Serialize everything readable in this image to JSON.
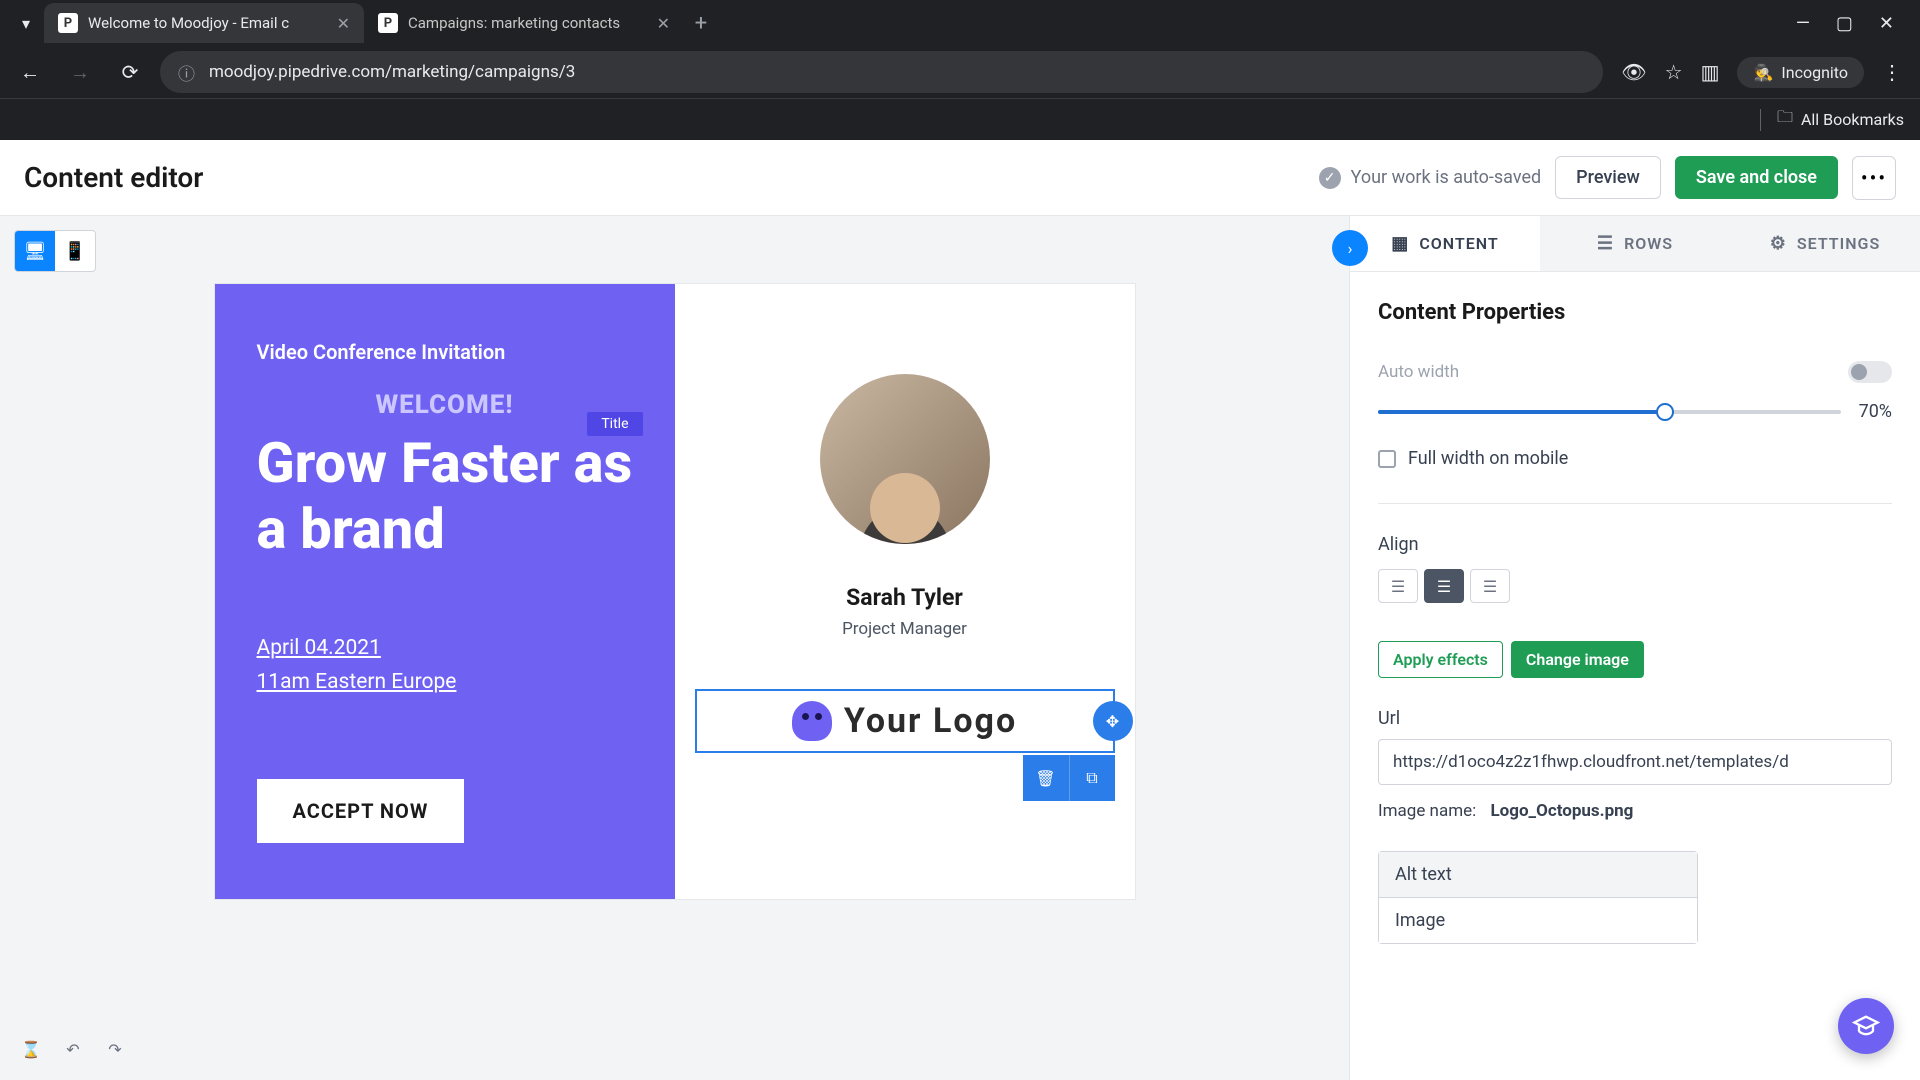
{
  "browser": {
    "tabs": [
      {
        "title": "Welcome to Moodjoy - Email c",
        "favicon": "P"
      },
      {
        "title": "Campaigns: marketing contacts",
        "favicon": "P"
      }
    ],
    "url": "moodjoy.pipedrive.com/marketing/campaigns/3",
    "incognito_label": "Incognito",
    "all_bookmarks": "All Bookmarks"
  },
  "appbar": {
    "title": "Content editor",
    "autosave": "Your work is auto-saved",
    "preview": "Preview",
    "save": "Save and close"
  },
  "tabs": {
    "content": "CONTENT",
    "rows": "ROWS",
    "settings": "SETTINGS"
  },
  "canvas": {
    "eyebrow": "Video Conference Invitation",
    "welcome": "WELCOME!",
    "title_badge": "Title",
    "headline": "Grow Faster as a brand",
    "date": "April 04.2021",
    "time": "11am Eastern Europe",
    "accept": "ACCEPT NOW",
    "person_name": "Sarah Tyler",
    "person_role": "Project Manager",
    "logo_text": "Your Logo"
  },
  "props": {
    "heading": "Content Properties",
    "auto_width": "Auto width",
    "width_value": "70%",
    "width_fill_pct": 62,
    "full_width_mobile": "Full width on mobile",
    "align_label": "Align",
    "apply_effects": "Apply effects",
    "change_image": "Change image",
    "url_label": "Url",
    "url_value": "https://d1oco4z2z1fhwp.cloudfront.net/templates/d",
    "image_name_label": "Image name:",
    "image_name_value": "Logo_Octopus.png",
    "alt_tab": "Alt text",
    "alt_value": "Image"
  }
}
